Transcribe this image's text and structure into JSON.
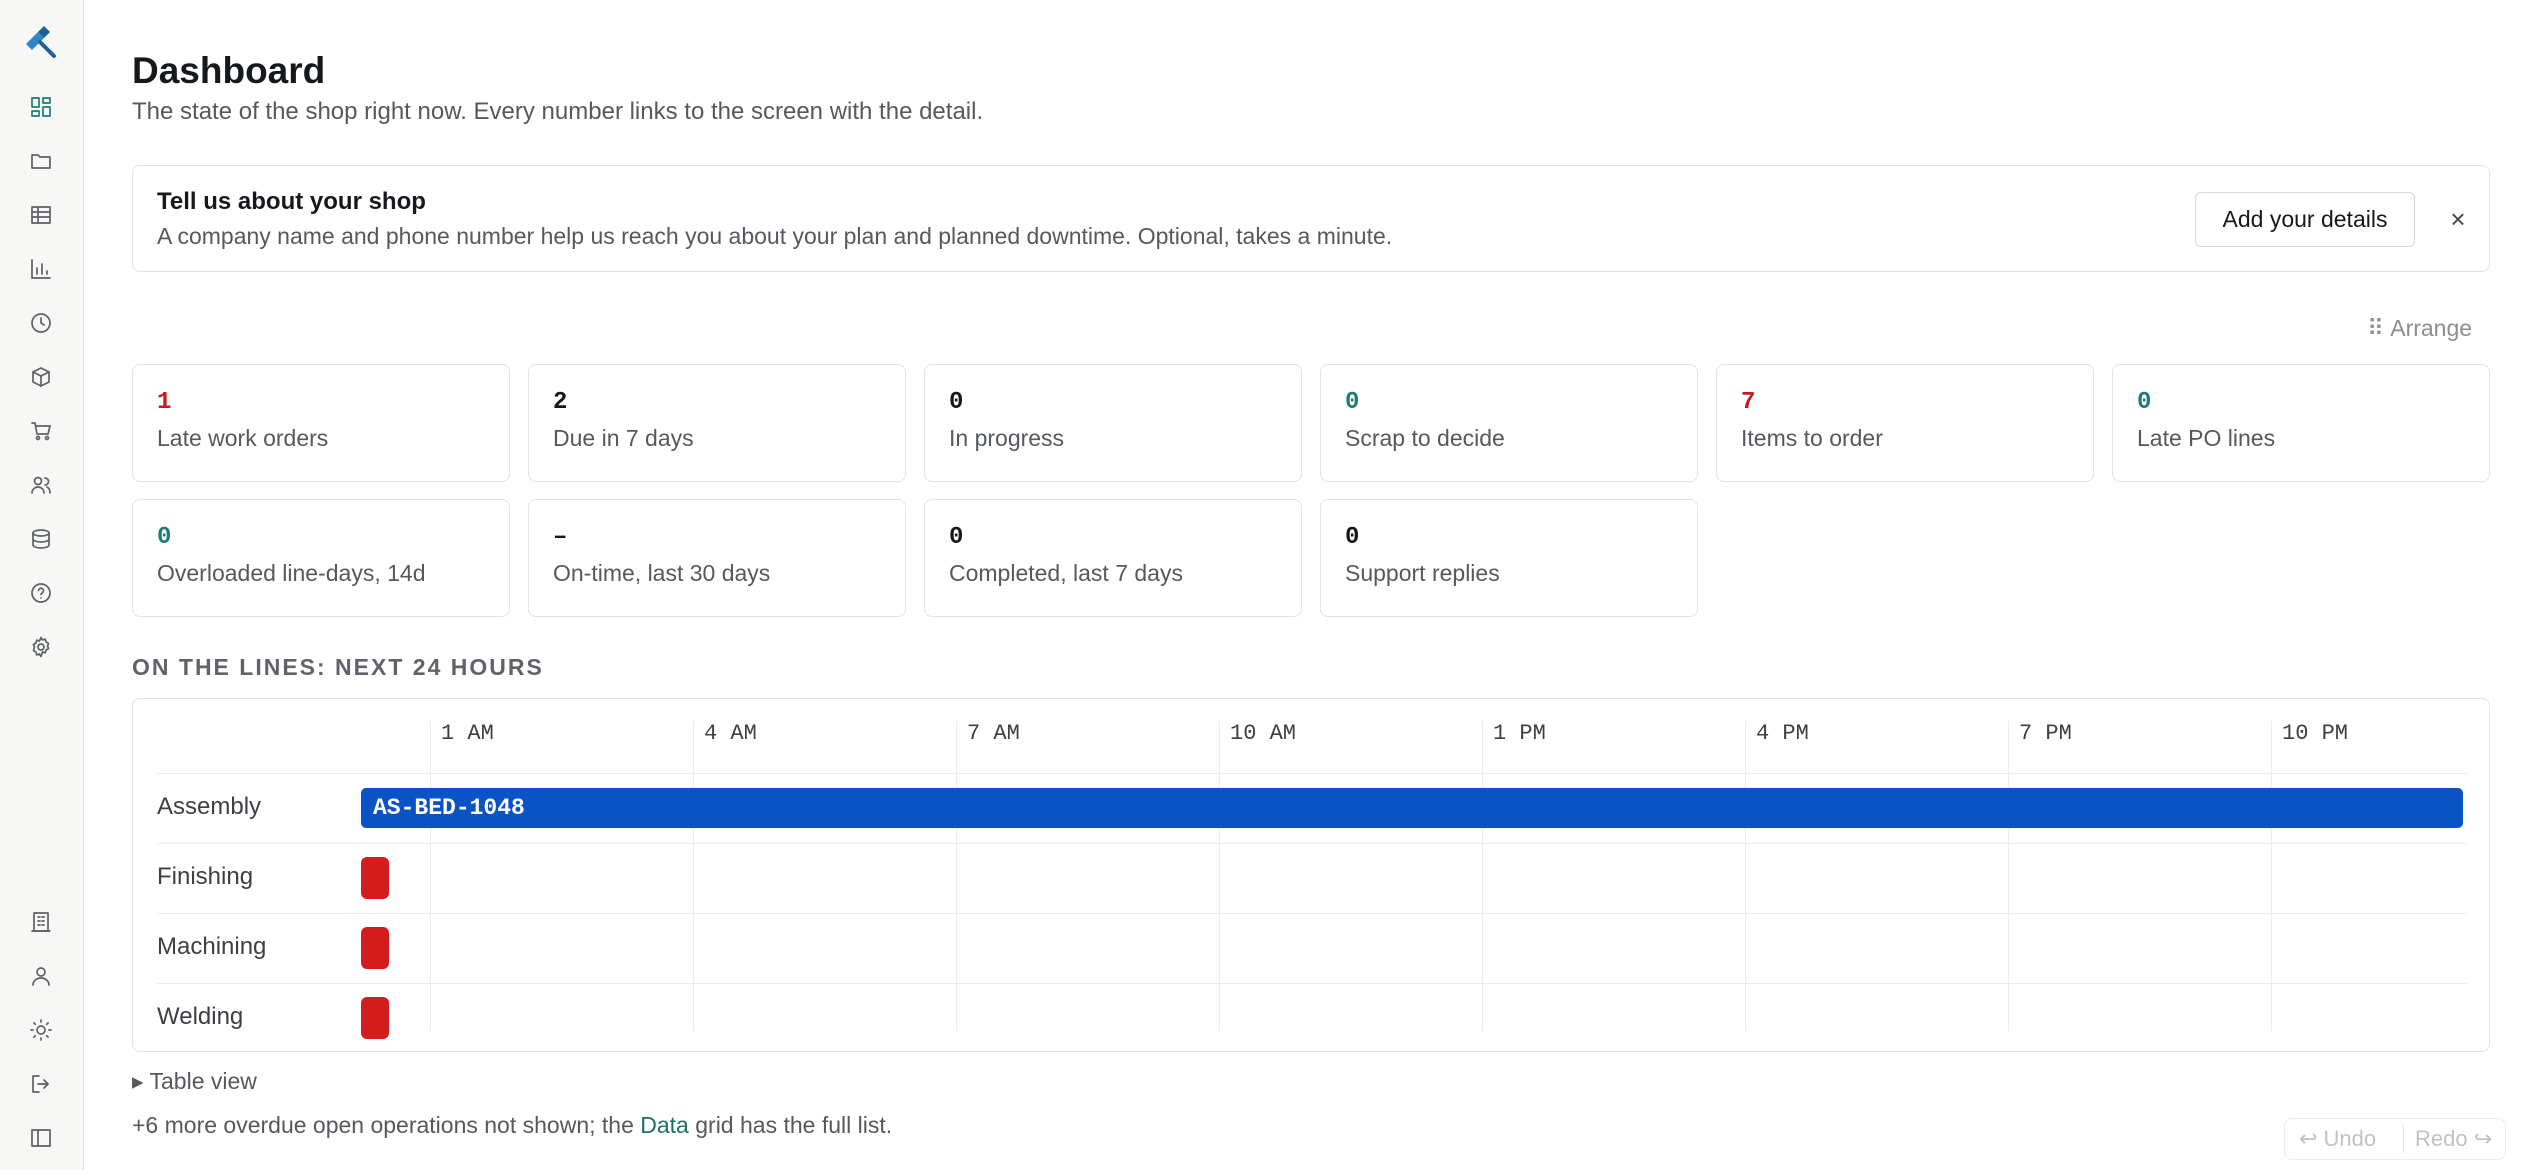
{
  "page": {
    "title": "Dashboard",
    "subtitle": "The state of the shop right now. Every number links to the screen with the detail."
  },
  "banner": {
    "title": "Tell us about your shop",
    "text": "A company name and phone number help us reach you about your plan and planned downtime. Optional, takes a minute.",
    "button": "Add your details",
    "close": "×"
  },
  "arrange_label": "⠿ Arrange",
  "kpis": [
    {
      "value": "1",
      "label": "Late work orders",
      "color": "#c8191f"
    },
    {
      "value": "2",
      "label": "Due in 7 days",
      "color": "#15191c"
    },
    {
      "value": "0",
      "label": "In progress",
      "color": "#15191c"
    },
    {
      "value": "0",
      "label": "Scrap to decide",
      "color": "#1f7a79"
    },
    {
      "value": "7",
      "label": "Items to order",
      "color": "#c8191f"
    },
    {
      "value": "0",
      "label": "Late PO lines",
      "color": "#1f7a79"
    },
    {
      "value": "0",
      "label": "Overloaded line-days, 14d",
      "color": "#1f7a79"
    },
    {
      "value": "–",
      "label": "On-time, last 30 days",
      "color": "#15191c"
    },
    {
      "value": "0",
      "label": "Completed, last 7 days",
      "color": "#15191c"
    },
    {
      "value": "0",
      "label": "Support replies",
      "color": "#15191c"
    }
  ],
  "schedule": {
    "title": "ON THE LINES: NEXT 24 HOURS",
    "hours": [
      "1 AM",
      "4 AM",
      "7 AM",
      "10 AM",
      "1 PM",
      "4 PM",
      "7 PM",
      "10 PM"
    ],
    "lines": [
      "Assembly",
      "Finishing",
      "Machining",
      "Welding"
    ],
    "job_label": "AS-BED-1048",
    "job_color": "#0a53c7",
    "late_color": "#d41c1c"
  },
  "table_view_label": "▸ Table view",
  "footer": {
    "prefix": "+6 more overdue open operations not shown; the ",
    "link": "Data",
    "suffix": " grid has the full list."
  },
  "history": {
    "undo": "↩ Undo",
    "redo": "Redo ↪"
  },
  "sidebar": {
    "top_icons": [
      "dashboard-icon",
      "folder-icon",
      "table-icon",
      "chart-icon",
      "clock-icon",
      "box-icon",
      "cart-icon",
      "users-icon",
      "database-icon",
      "help-icon",
      "settings-icon"
    ],
    "bottom_icons": [
      "building-icon",
      "user-icon",
      "sun-icon",
      "logout-icon",
      "sidebar-toggle-icon"
    ]
  }
}
